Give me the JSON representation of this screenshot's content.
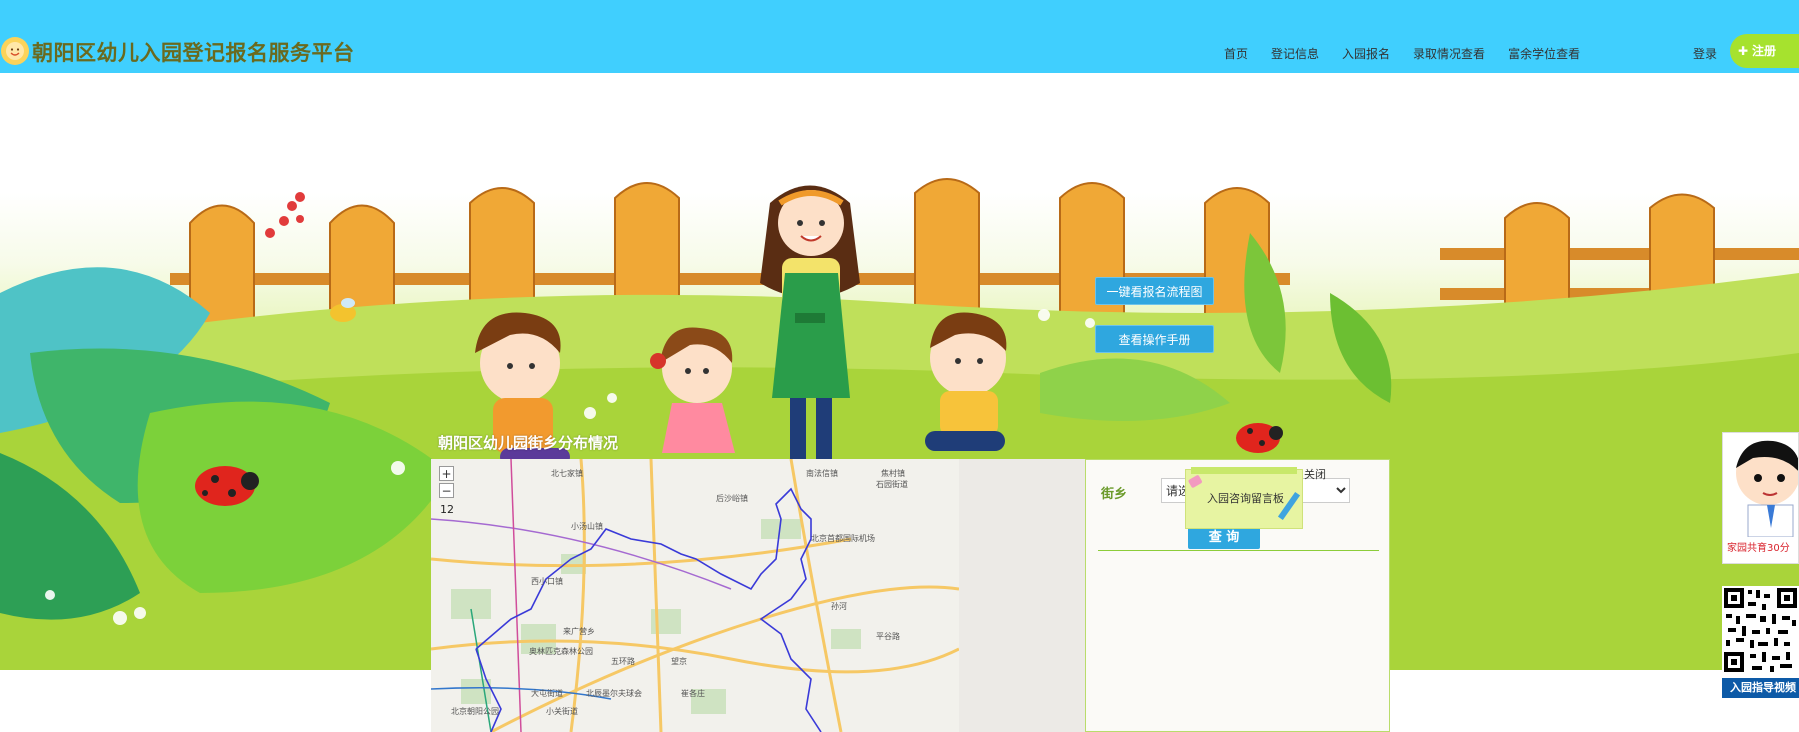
{
  "header": {
    "site_title": "朝阳区幼儿入园登记报名服务平台",
    "nav": [
      "首页",
      "登记信息",
      "入园报名",
      "录取情况查看",
      "富余学位查看"
    ],
    "login_label": "登录",
    "register_label": "注册",
    "bg_color": "#40CFFE"
  },
  "hero": {
    "flow_button": "一键看报名流程图",
    "manual_button": "查看操作手册"
  },
  "map": {
    "title": "朝阳区幼儿园街乡分布情况",
    "zoom_in": "+",
    "zoom_out": "−",
    "zoom_level": "12",
    "labels": [
      "北七家镇",
      "南法信镇",
      "焦村镇",
      "石园街道",
      "后沙峪镇",
      "小汤山镇",
      "北京首都国际机场",
      "西小口镇",
      "来广营乡",
      "奥林匹克森林公园",
      "五环路",
      "望京",
      "大屯街道",
      "北京朝阳公园",
      "北辰墨尔夫球会",
      "小关街道",
      "孙河",
      "崔各庄",
      "平谷路"
    ]
  },
  "panel": {
    "street_label": "街乡",
    "street_select_value": "请选择",
    "query_button": "查 询"
  },
  "consult": {
    "label": "入园咨询留言板",
    "close_label": "关闭"
  },
  "floating": {
    "cartoon_caption": "家园共育30分",
    "qr_caption": "入园指导视频"
  },
  "colors": {
    "accent_blue": "#2FA7DF",
    "register_green": "#A6E22E",
    "title_olive": "#6a6a1f"
  }
}
